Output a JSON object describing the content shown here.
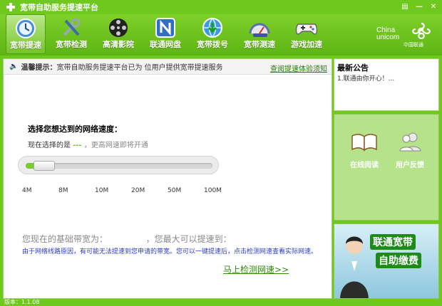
{
  "app": {
    "title": "宽带自助服务提速平台"
  },
  "toolbar": {
    "items": [
      {
        "label": "宽带提速",
        "icon": "clock-icon",
        "active": true
      },
      {
        "label": "宽带检测",
        "icon": "tools-icon",
        "active": false
      },
      {
        "label": "高清影院",
        "icon": "film-reel-icon",
        "active": false
      },
      {
        "label": "联通网盘",
        "icon": "netdisk-n-icon",
        "active": false
      },
      {
        "label": "宽带拨号",
        "icon": "globe-dial-icon",
        "active": false
      },
      {
        "label": "宽带测速",
        "icon": "speed-test-icon",
        "active": false
      },
      {
        "label": "游戏加速",
        "icon": "gamepad-icon",
        "active": false
      }
    ]
  },
  "brand": {
    "en_line1": "China",
    "en_line2": "unicom",
    "cn": "中国联通"
  },
  "notice": {
    "label": "温馨提示：",
    "text": "宽带自助服务提速平台已为 位用户提供宽带提速服务",
    "link": "查阅提速体验须知"
  },
  "speed": {
    "question": "选择您想达到的网络速度：",
    "current_prefix": "现在选择的是",
    "current_value": "---",
    "current_suffix": "，更高网速即将开通",
    "selected_fraction": 0.08,
    "ticks": [
      "4M",
      "8M",
      "10M",
      "20M",
      "50M",
      "100M"
    ]
  },
  "basic": {
    "prefix": "您现在的基础带宽为：",
    "suffix": "，您最大可以提速到："
  },
  "note": "由于网络线路原因，有可能无法提速到您申请的带宽。您可以一键提速后，点击检测网速查看实际网速。",
  "detect_link": "马上检测网速>>",
  "news": {
    "header": "最新公告",
    "items": [
      "1.联通由你开心！..."
    ]
  },
  "panel": {
    "items": [
      {
        "label": "在线阅读",
        "icon": "open-book-icon"
      },
      {
        "label": "用户反馈",
        "icon": "users-icon"
      }
    ]
  },
  "ad": {
    "line1": "联通宽带",
    "line2": "自助缴费"
  },
  "status": {
    "version": "版本：1.1.08"
  },
  "colors": {
    "brand_green": "#6fc81e",
    "link_green": "#2f8a0e",
    "note_blue": "#2b39c9"
  }
}
